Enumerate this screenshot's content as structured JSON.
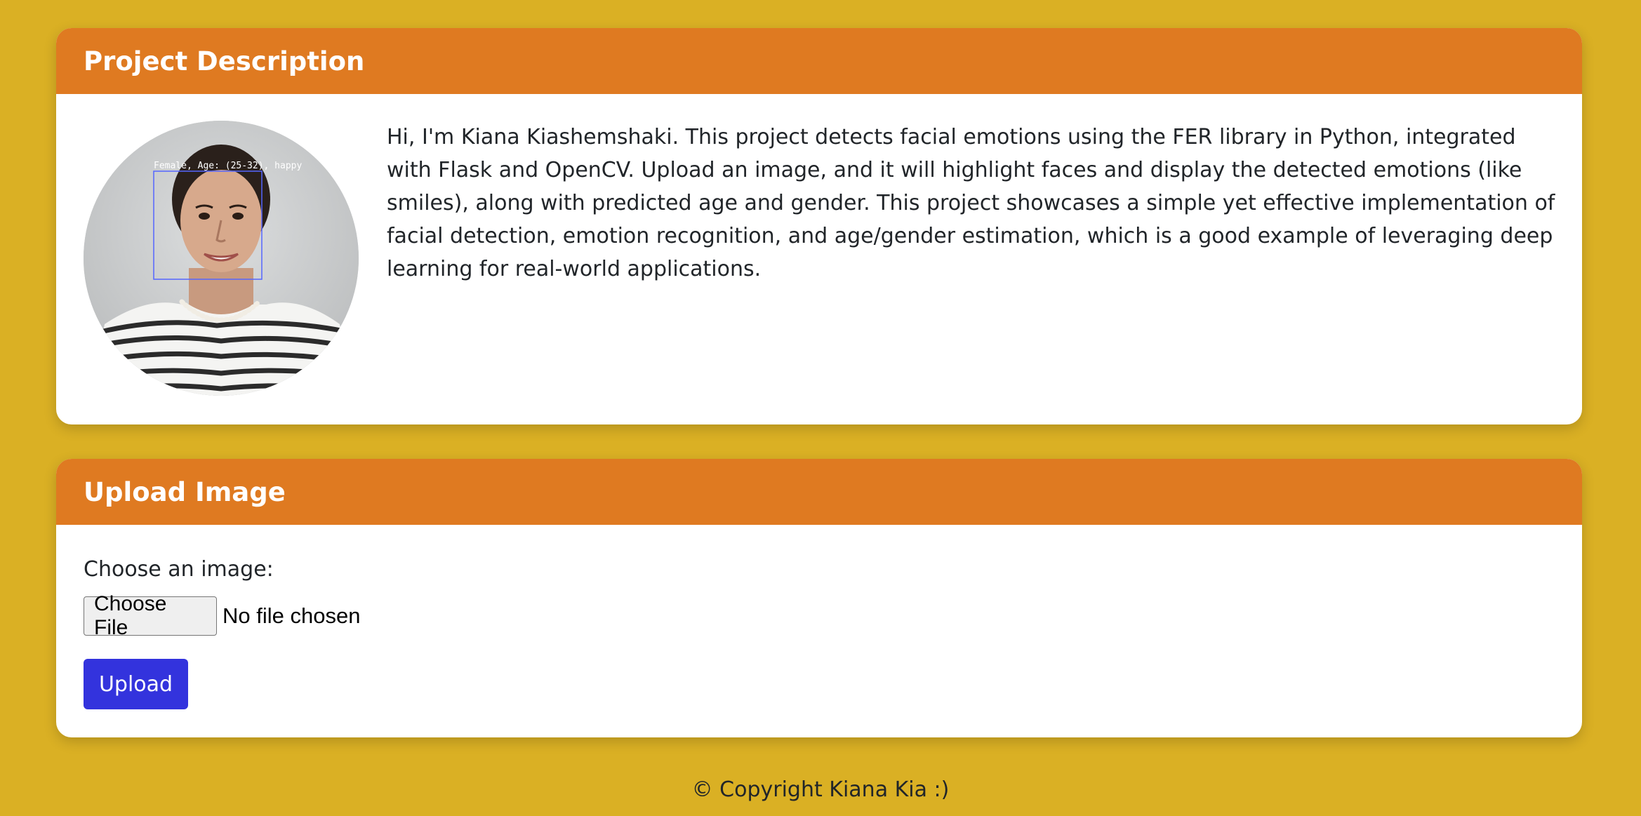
{
  "description_card": {
    "title": "Project Description",
    "image_overlay_label": "Female, Age: (25-32), happy",
    "text": "Hi, I'm Kiana Kiashemshaki. This project detects facial emotions using the FER library in Python, integrated with Flask and OpenCV. Upload an image, and it will highlight faces and display the detected emotions (like smiles), along with predicted age and gender. This project showcases a simple yet effective implementation of facial detection, emotion recognition, and age/gender estimation, which is a good example of leveraging deep learning for real-world applications."
  },
  "upload_card": {
    "title": "Upload Image",
    "choose_label": "Choose an image:",
    "file_button_label": "Choose File",
    "file_status": "No file chosen",
    "upload_button_label": "Upload"
  },
  "footer": {
    "text": "© Copyright Kiana Kia :)"
  },
  "colors": {
    "page_background": "#DAB024",
    "card_header": "#DF7A21",
    "upload_button": "#3333DD"
  }
}
